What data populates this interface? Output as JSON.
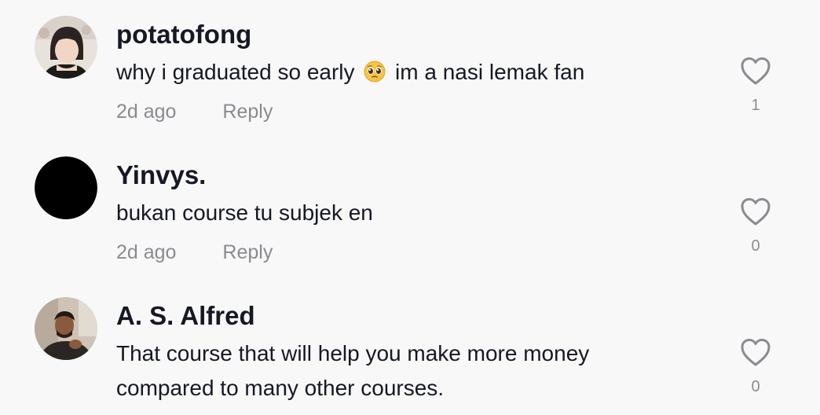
{
  "comments": [
    {
      "username": "potatofong",
      "text_before_emoji": "why i graduated so early",
      "emoji": "pleading-face-emoji",
      "text_after_emoji": "im a nasi lemak fan",
      "time": "2d ago",
      "reply_label": "Reply",
      "likes": "1"
    },
    {
      "username": "Yinvys.",
      "text": "bukan course tu subjek en",
      "time": "2d ago",
      "reply_label": "Reply",
      "likes": "0"
    },
    {
      "username": "A. S. Alfred",
      "text": "That course that will help you make more money compared to many other courses.",
      "likes": "0"
    }
  ],
  "colors": {
    "background": "#f8f8f8",
    "text_primary": "#161823",
    "text_secondary": "#8a8b91"
  }
}
